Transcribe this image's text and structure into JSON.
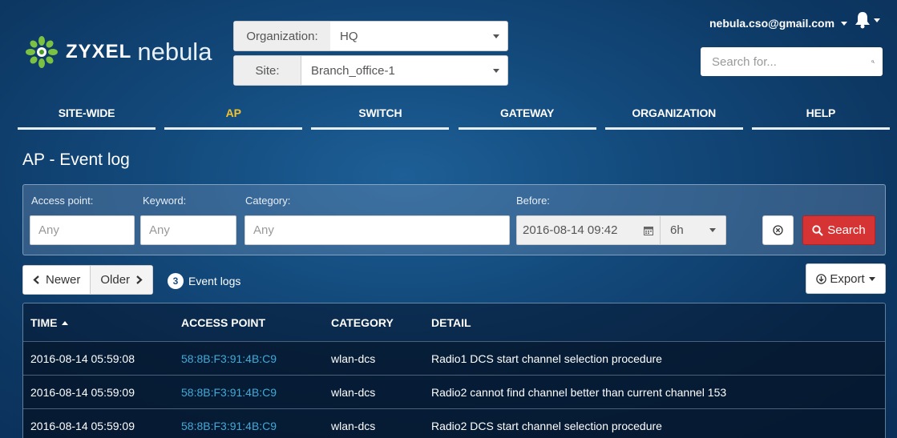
{
  "brand": {
    "name_bold": "ZYXEL",
    "name_light": "nebula"
  },
  "selectors": {
    "organization": {
      "label": "Organization:",
      "value": "HQ"
    },
    "site": {
      "label": "Site:",
      "value": "Branch_office-1"
    }
  },
  "account": {
    "email": "nebula.cso@gmail.com"
  },
  "top_search": {
    "placeholder": "Search for..."
  },
  "nav": {
    "tabs": [
      {
        "label": "SITE-WIDE",
        "active": false
      },
      {
        "label": "AP",
        "active": true
      },
      {
        "label": "SWITCH",
        "active": false
      },
      {
        "label": "GATEWAY",
        "active": false
      },
      {
        "label": "ORGANIZATION",
        "active": false
      },
      {
        "label": "HELP",
        "active": false
      }
    ]
  },
  "page": {
    "title": "AP - Event log"
  },
  "filter": {
    "access_point": {
      "label": "Access point:",
      "placeholder": "Any"
    },
    "keyword": {
      "label": "Keyword:",
      "placeholder": "Any"
    },
    "category": {
      "label": "Category:",
      "placeholder": "Any"
    },
    "before": {
      "label": "Before:",
      "datetime": "2016-08-14 09:42",
      "range": "6h"
    },
    "search_button": "Search"
  },
  "pager": {
    "newer": "Newer",
    "older": "Older"
  },
  "event_count": {
    "count": "3",
    "label": "Event logs"
  },
  "export_button": "Export",
  "table": {
    "columns": [
      "TIME",
      "ACCESS POINT",
      "CATEGORY",
      "DETAIL"
    ],
    "rows": [
      {
        "time": "2016-08-14 05:59:08",
        "ap": "58:8B:F3:91:4B:C9",
        "category": "wlan-dcs",
        "detail": "Radio1 DCS start channel selection procedure"
      },
      {
        "time": "2016-08-14 05:59:09",
        "ap": "58:8B:F3:91:4B:C9",
        "category": "wlan-dcs",
        "detail": "Radio2 cannot find channel better than current channel 153"
      },
      {
        "time": "2016-08-14 05:59:09",
        "ap": "58:8B:F3:91:4B:C9",
        "category": "wlan-dcs",
        "detail": "Radio2 DCS start channel selection procedure"
      }
    ]
  },
  "colors": {
    "active_tab": "#f2c230",
    "search_button": "#d63434",
    "link": "#41a9d6"
  },
  "icons": [
    "nebula-logo-icon",
    "chevron-down-icon",
    "bell-icon",
    "magnifier-icon",
    "calendar-icon",
    "clear-icon",
    "chevron-left-icon",
    "chevron-right-icon",
    "download-icon"
  ]
}
